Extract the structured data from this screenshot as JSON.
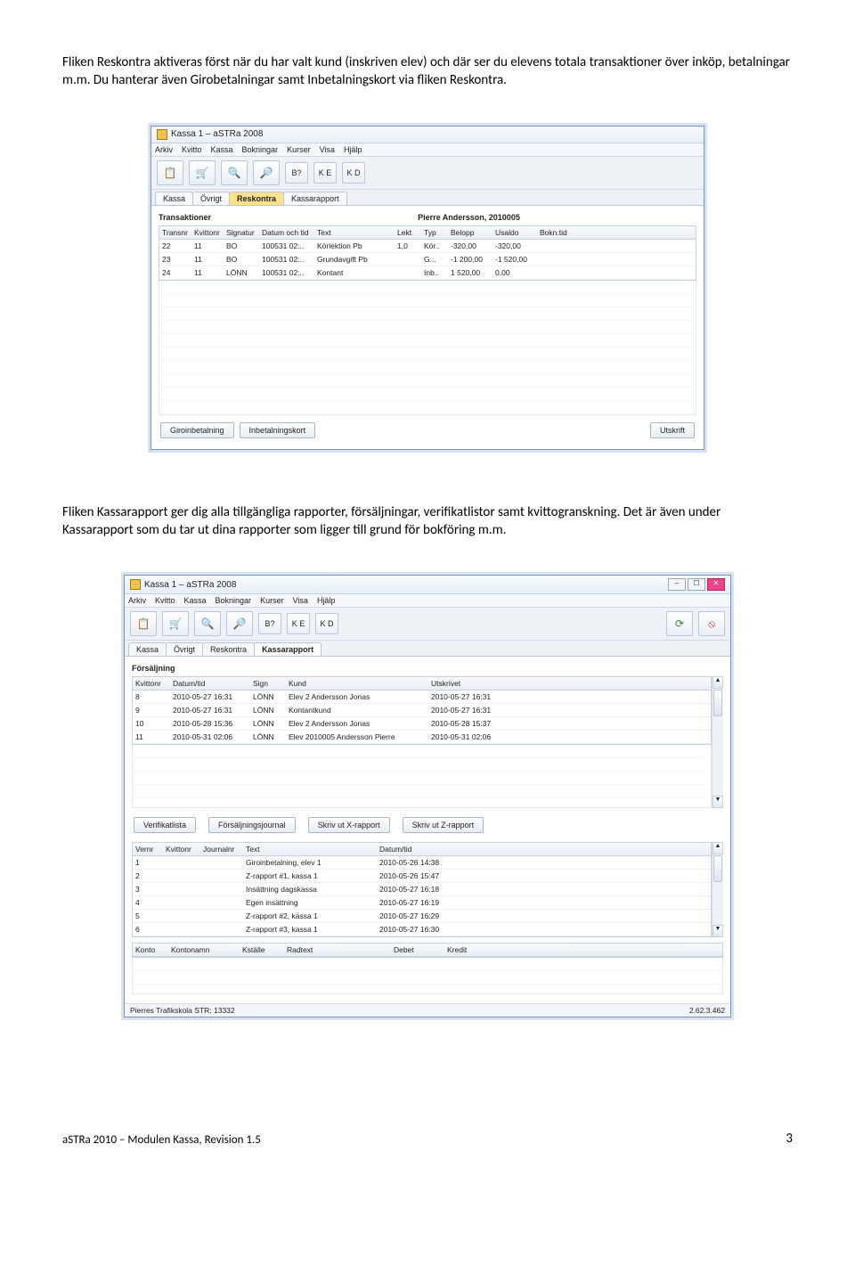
{
  "paragraphs": {
    "p1": "Fliken Reskontra aktiveras först när du har valt kund (inskriven elev) och där ser du elevens totala transaktioner över inköp, betalningar m.m. Du hanterar även Girobetalningar samt Inbetalningskort via fliken Reskontra.",
    "p2": "Fliken Kassarapport ger dig alla tillgängliga rapporter, försäljningar, verifikatlistor samt kvittogranskning. Det är även under Kassarapport som du tar ut dina rapporter som ligger till grund för bokföring m.m."
  },
  "common": {
    "app_title": "Kassa 1 – aSTRa 2008",
    "menu": [
      "Arkiv",
      "Kvitto",
      "Kassa",
      "Bokningar",
      "Kurser",
      "Visa",
      "Hjälp"
    ],
    "tabs": {
      "kassa": "Kassa",
      "ovrigt": "Övrigt",
      "reskontra": "Reskontra",
      "kassarapport": "Kassarapport"
    }
  },
  "reskontra": {
    "section": "Transaktioner",
    "customer": "Pierre Andersson, 2010005",
    "headers": [
      "Transnr",
      "Kvittonr",
      "Signatur",
      "Datum och tid",
      "Text",
      "Lekt",
      "Typ",
      "Belopp",
      "Usaldo",
      "Bokn.tid"
    ],
    "rows": [
      [
        "22",
        "11",
        "BO",
        "100531 02:..",
        "Körlektion Pb",
        "1,0",
        "Kör..",
        "-320,00",
        "-320,00",
        ""
      ],
      [
        "23",
        "11",
        "BO",
        "100531 02:..",
        "Grundavgift Pb",
        "",
        "G...",
        "-1 200,00",
        "-1 520,00",
        ""
      ],
      [
        "24",
        "11",
        "LÖNN",
        "100531 02:..",
        "Kontant",
        "",
        "Inb..",
        "1 520,00",
        "0,00",
        ""
      ]
    ],
    "buttons": {
      "giro": "Giroinbetalning",
      "inbet": "Inbetalningskort",
      "utskrift": "Utskrift"
    }
  },
  "rapport": {
    "section_sales": "Försäljning",
    "sales_headers": [
      "Kvittonr",
      "Datum/tid",
      "Sign",
      "Kund",
      "Utskrivet"
    ],
    "sales_rows": [
      [
        "8",
        "2010-05-27 16:31",
        "LÖNN",
        "Elev 2 Andersson Jonas",
        "2010-05-27 16:31"
      ],
      [
        "9",
        "2010-05-27 16:31",
        "LÖNN",
        "Kontantkund",
        "2010-05-27 16:31"
      ],
      [
        "10",
        "2010-05-28 15:36",
        "LÖNN",
        "Elev 2 Andersson Jonas",
        "2010-05-28 15:37"
      ],
      [
        "11",
        "2010-05-31 02:06",
        "LÖNN",
        "Elev 2010005 Andersson Pierre",
        "2010-05-31 02:06"
      ]
    ],
    "mid_buttons": {
      "verif": "Verifikatlista",
      "journal": "Försäljningsjournal",
      "xrapport": "Skriv ut X-rapport",
      "zrapport": "Skriv ut Z-rapport"
    },
    "verif_headers": [
      "Vernr",
      "Kvittonr",
      "Journalnr",
      "Text",
      "Datum/tid"
    ],
    "verif_rows": [
      [
        "1",
        "",
        "",
        "Giroinbetalning, elev 1",
        "2010-05-26 14:38"
      ],
      [
        "2",
        "",
        "",
        "Z-rapport #1, kassa 1",
        "2010-05-26 15:47"
      ],
      [
        "3",
        "",
        "",
        "Insättning dagskassa",
        "2010-05-27 16:18"
      ],
      [
        "4",
        "",
        "",
        "Egen insättning",
        "2010-05-27 16:19"
      ],
      [
        "5",
        "",
        "",
        "Z-rapport #2, kassa 1",
        "2010-05-27 16:29"
      ],
      [
        "6",
        "",
        "",
        "Z-rapport #3, kassa 1",
        "2010-05-27 16:30"
      ]
    ],
    "post_headers": [
      "Konto",
      "Kontonamn",
      "Kställe",
      "Radtext",
      "Debet",
      "Kredit"
    ],
    "status_left": "Pierres Trafikskola STR: 13332",
    "status_right": "2.62.3.462"
  },
  "footer": {
    "left": "aSTRa 2010 – Modulen Kassa, Revision 1.5",
    "page": "3"
  }
}
